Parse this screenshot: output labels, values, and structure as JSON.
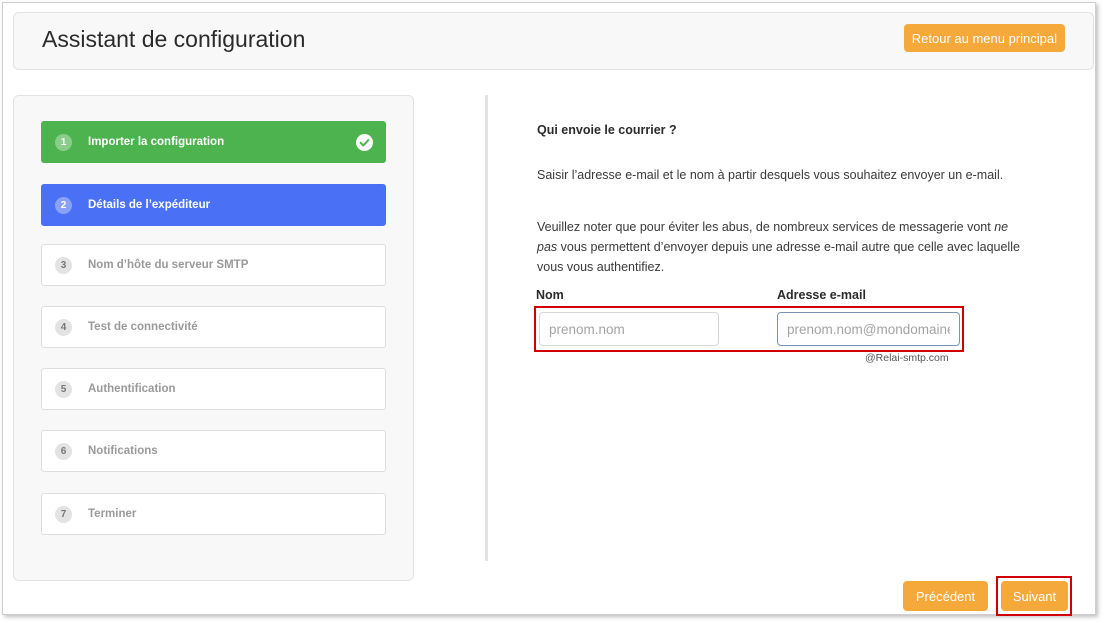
{
  "header": {
    "title": "Assistant de configuration",
    "back_label": "Retour au menu principal"
  },
  "steps": [
    {
      "num": "1",
      "label": "Importer la configuration",
      "state": "done"
    },
    {
      "num": "2",
      "label": "Détails de l’expéditeur",
      "state": "active"
    },
    {
      "num": "3",
      "label": "Nom d’hôte du serveur SMTP",
      "state": "pending"
    },
    {
      "num": "4",
      "label": "Test de connectivité",
      "state": "pending"
    },
    {
      "num": "5",
      "label": "Authentification",
      "state": "pending"
    },
    {
      "num": "6",
      "label": "Notifications",
      "state": "pending"
    },
    {
      "num": "7",
      "label": "Terminer",
      "state": "pending"
    }
  ],
  "content": {
    "title": "Qui envoie le courrier ?",
    "para1": "Saisir l’adresse e-mail et le nom à partir desquels vous souhaitez envoyer un e-mail.",
    "para2_before": "Veuillez noter que pour éviter les abus, de nombreux services de messagerie vont ",
    "para2_em": "ne pas",
    "para2_after": " vous permettent d’envoyer depuis une adresse e-mail autre que celle avec laquelle vous vous authentifiez.",
    "name_label": "Nom",
    "name_placeholder": "prenom.nom",
    "email_label": "Adresse e-mail",
    "email_placeholder": "prenom.nom@mondomaine.com",
    "domain_suffix": "@Relai-smtp.com"
  },
  "footer": {
    "prev_label": "Précédent",
    "next_label": "Suivant"
  },
  "colors": {
    "accent_orange": "#f6a93b",
    "done_green": "#4cb34e",
    "active_blue": "#4a70f5",
    "highlight_red": "#d10000"
  }
}
